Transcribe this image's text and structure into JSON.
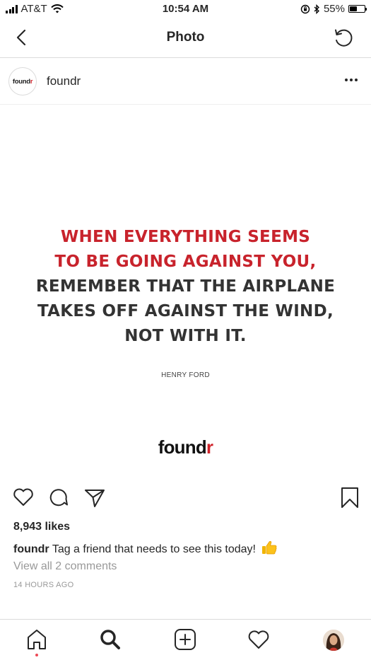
{
  "status_bar": {
    "carrier": "AT&T",
    "time": "10:54 AM",
    "battery_percent": "55%",
    "battery_level": 0.55
  },
  "nav": {
    "title": "Photo"
  },
  "post": {
    "avatar_logo": {
      "prefix": "found",
      "suffix": "r"
    },
    "username": "foundr",
    "quote_red": [
      "WHEN EVERYTHING SEEMS",
      "TO BE GOING AGAINST YOU,"
    ],
    "quote_dark": [
      "REMEMBER THAT THE AIRPLANE",
      "TAKES OFF AGAINST THE WIND,",
      "NOT WITH IT."
    ],
    "author": "HENRY FORD",
    "brand_logo": {
      "prefix": "found",
      "suffix": "r"
    },
    "likes": "8,943 likes",
    "caption_user": "foundr",
    "caption_text": "Tag a friend that needs to see this today!",
    "caption_emoji": "thumbs-up",
    "view_comments": "View all 2 comments",
    "timestamp": "14 HOURS AGO"
  },
  "colors": {
    "quote_red": "#c8232c",
    "quote_dark": "#333333",
    "brand_accent": "#d0232a",
    "notification_dot": "#ed4956",
    "muted_text": "#999999"
  },
  "icons": {
    "nav": [
      "chevron-left-icon",
      "refresh-icon"
    ],
    "actions": [
      "heart-icon",
      "comment-icon",
      "share-icon",
      "bookmark-icon"
    ],
    "tabs": [
      "home-icon",
      "search-icon",
      "add-post-icon",
      "activity-heart-icon",
      "profile-avatar"
    ]
  }
}
